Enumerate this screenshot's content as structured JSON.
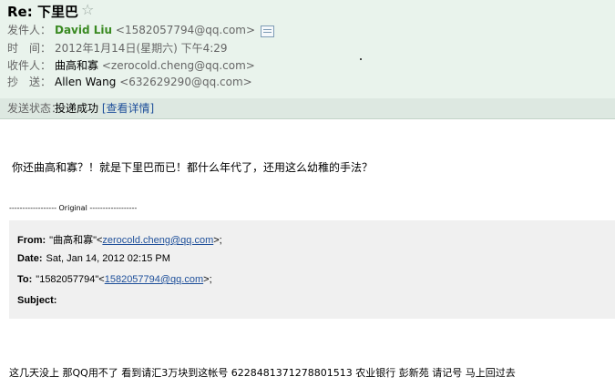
{
  "header": {
    "subject": "Re: 下里巴",
    "star_icon": "star-outline-icon",
    "from_label": "发件人：",
    "from_name": "David Liu",
    "from_addr": "<1582057794@qq.com>",
    "time_label": "时　间：",
    "time_value": "2012年1月14日(星期六) 下午4:29",
    "to_label": "收件人：",
    "to_name": "曲高和寡",
    "to_addr": "<zerocold.cheng@qq.com>",
    "cc_label": "抄　送：",
    "cc_name": "Allen Wang",
    "cc_addr": "<632629290@qq.com>"
  },
  "status": {
    "label": "发送状态：",
    "value": "投递成功",
    "details_link": "[查看详情]"
  },
  "body": {
    "line1": "你还曲高和寡？！就是下里巴而已！都什么年代了，还用这么幼稚的手法？",
    "original_marker": "------------------ Original ------------------",
    "quote": {
      "from_label": "From:",
      "from_name": "\"曲高和寡\"<",
      "from_link": "zerocold.cheng@qq.com",
      "from_end": ">;",
      "date_label": "Date:",
      "date_value": "Sat, Jan 14, 2012 02:15 PM",
      "to_label": "To:",
      "to_name": "\"1582057794\"<",
      "to_link": "1582057794@qq.com",
      "to_end": ">;",
      "subject_label": "Subject:"
    },
    "line2": "这几天没上 那QQ用不了 看到请汇3万块到这帐号 6228481371278801513 农业银行 彭新苑 请记号 马上回过去"
  }
}
